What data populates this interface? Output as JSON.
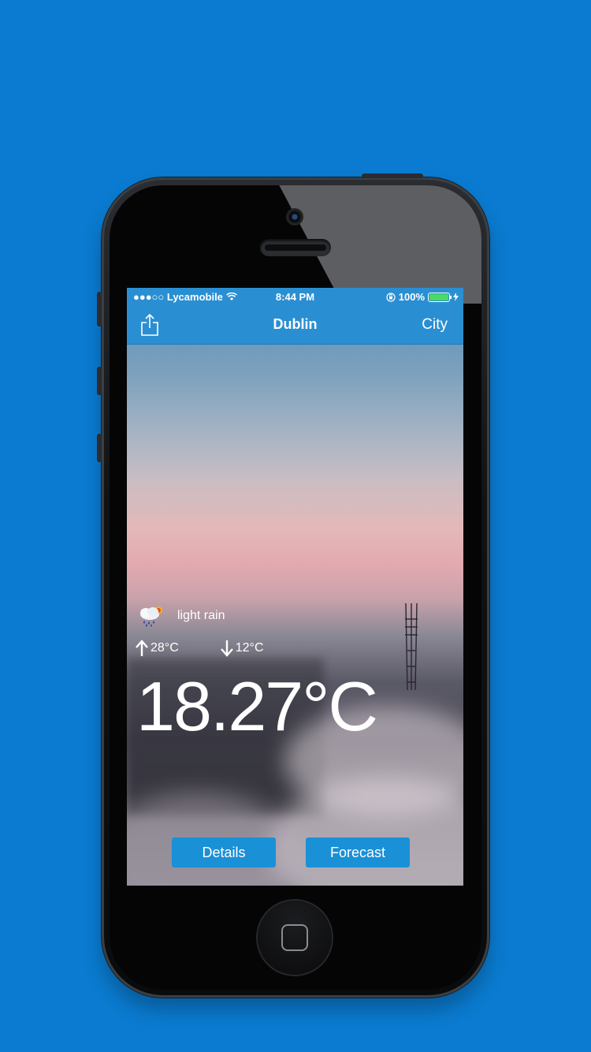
{
  "statusbar": {
    "carrier": "●●●○○ Lycamobile",
    "time": "8:44 PM",
    "battery_pct": "100%",
    "battery_level": 1.0
  },
  "navbar": {
    "title": "Dublin",
    "right_label": "City"
  },
  "weather": {
    "condition": "light rain",
    "high": "28°C",
    "low": "12°C",
    "temperature": "18.27°C",
    "icon": "rain-cloud-sun-icon"
  },
  "buttons": {
    "details": "Details",
    "forecast": "Forecast"
  },
  "colors": {
    "background": "#0a7bd0",
    "navbar": "#2a8fd2",
    "button": "#1a90d6",
    "battery": "#4cd964"
  }
}
